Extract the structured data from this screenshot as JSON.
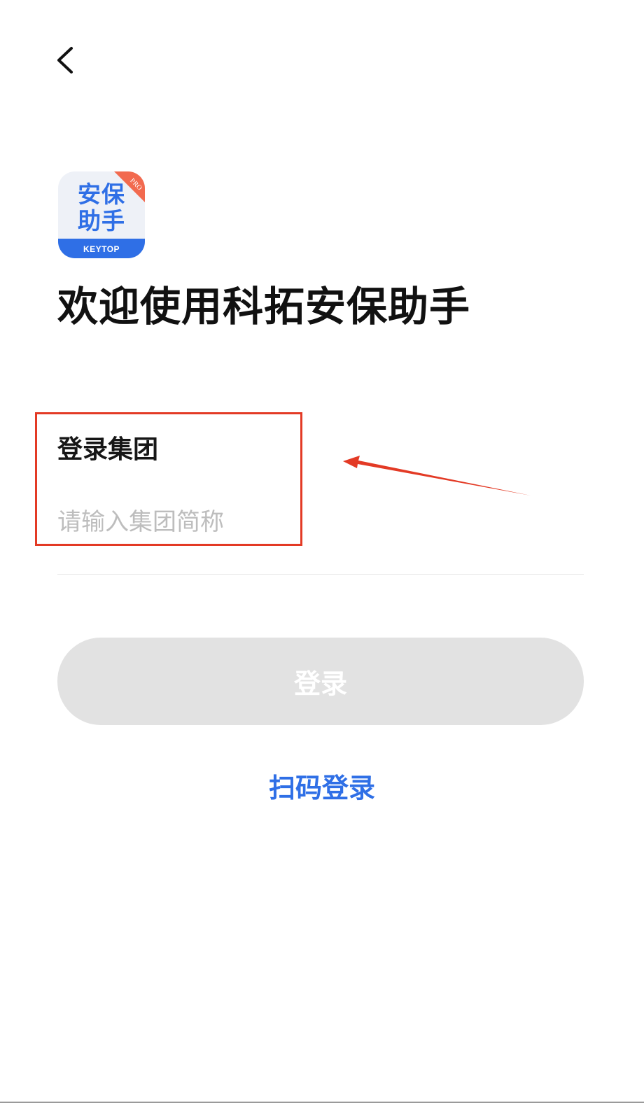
{
  "nav": {
    "back_icon": "chevron-left-icon"
  },
  "app_icon": {
    "name_line1": "安保",
    "name_line2": "助手",
    "brand": "KEYTOP",
    "badge": "PRO",
    "colors": {
      "primary": "#2f6fe6",
      "badge": "#f26a4f",
      "background": "#eef1f7"
    }
  },
  "welcome": {
    "title": "欢迎使用科拓安保助手"
  },
  "form": {
    "group_label": "登录集团",
    "group_input": {
      "value": "",
      "placeholder": "请输入集团简称"
    },
    "login_button": "登录",
    "scan_login": "扫码登录"
  },
  "colors": {
    "accent": "#2f6fe6",
    "button_disabled": "#e2e2e2",
    "annotation": "#e33a25"
  }
}
